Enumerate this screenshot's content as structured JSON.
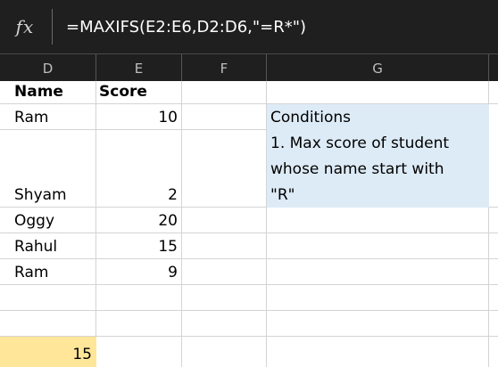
{
  "formula_bar": {
    "fx_label": "fx",
    "formula": "=MAXIFS(E2:E6,D2:D6,\"=R*\")"
  },
  "columns": [
    "D",
    "E",
    "F",
    "G"
  ],
  "table": {
    "header_name": "Name",
    "header_score": "Score",
    "rows": [
      {
        "name": "Ram",
        "score": "10"
      },
      {
        "name": "Shyam",
        "score": "2"
      },
      {
        "name": "Oggy",
        "score": "20"
      },
      {
        "name": "Rahul",
        "score": "15"
      },
      {
        "name": "Ram",
        "score": "9"
      }
    ]
  },
  "conditions": {
    "line1": "Conditions",
    "line2": "1. Max score of student",
    "line3": "whose name start with",
    "line4": "\"R\""
  },
  "result": "15",
  "colors": {
    "formula_bar_bg": "#1f1f1f",
    "conditions_bg": "#ddebf7",
    "result_bg": "#ffe699"
  }
}
